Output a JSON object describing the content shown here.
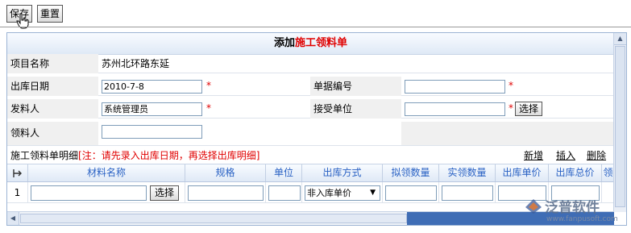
{
  "toolbar": {
    "save_label": "保存",
    "reset_label": "重置"
  },
  "form": {
    "title_prefix": "添加",
    "title_highlight": "施工领料单",
    "project_label": "项目名称",
    "project_value": "苏州北环路东延",
    "date_label": "出库日期",
    "date_value": "2010-7-8",
    "doc_no_label": "单据编号",
    "doc_no_value": "",
    "issuer_label": "发料人",
    "issuer_value": "系统管理员",
    "receiver_unit_label": "接受单位",
    "receiver_unit_value": "",
    "receiver_label": "领料人",
    "receiver_value": "",
    "required_mark": "*",
    "select_label": "选择"
  },
  "detail": {
    "title": "施工领料单明细",
    "note": "[注：请先录入出库日期，再选择出库明细]",
    "add_link": "新增",
    "insert_link": "插入",
    "delete_link": "删除",
    "columns": [
      "材料名称",
      "规格",
      "单位",
      "出库方式",
      "拟领数量",
      "实领数量",
      "出库单价",
      "出库总价",
      "领"
    ],
    "rows": [
      {
        "index": "1",
        "material": "",
        "select_label": "选择",
        "spec": "",
        "unit": "",
        "method": "非入库单价",
        "planned_qty": "",
        "actual_qty": "",
        "unit_price": "",
        "total_price": ""
      }
    ]
  },
  "watermark": {
    "text": "泛普软件",
    "url": "www.fanpusoft.com"
  },
  "colors": {
    "accent_red": "#e00000",
    "header_blue": "#2a62c4",
    "scroll_blue": "#3f6db5"
  }
}
